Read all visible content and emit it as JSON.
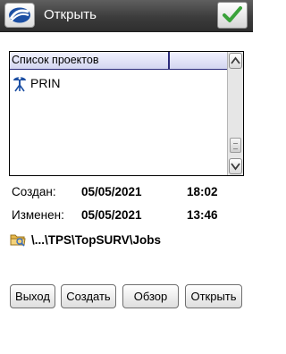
{
  "window": {
    "title": "Открыть",
    "logo_icon": "topcon-logo-icon",
    "ok_icon": "checkmark-icon"
  },
  "list": {
    "header": {
      "col1": "Список проектов",
      "col2": ""
    },
    "items": [
      {
        "name": "PRIN",
        "icon": "project-icon"
      }
    ]
  },
  "info": {
    "created": {
      "label": "Создан:",
      "date": "05/05/2021",
      "time": "18:02"
    },
    "modified": {
      "label": "Изменен:",
      "date": "05/05/2021",
      "time": "13:46"
    }
  },
  "path": {
    "icon": "folder-icon",
    "text": "\\...\\TPS\\TopSURV\\Jobs"
  },
  "buttons": {
    "exit": "Выход",
    "create": "Создать",
    "browse": "Обзор",
    "open": "Открыть"
  },
  "colors": {
    "titlebar": "#3c3c3c",
    "header_border": "#2a2a7a",
    "ok_check": "#3aa23a"
  }
}
